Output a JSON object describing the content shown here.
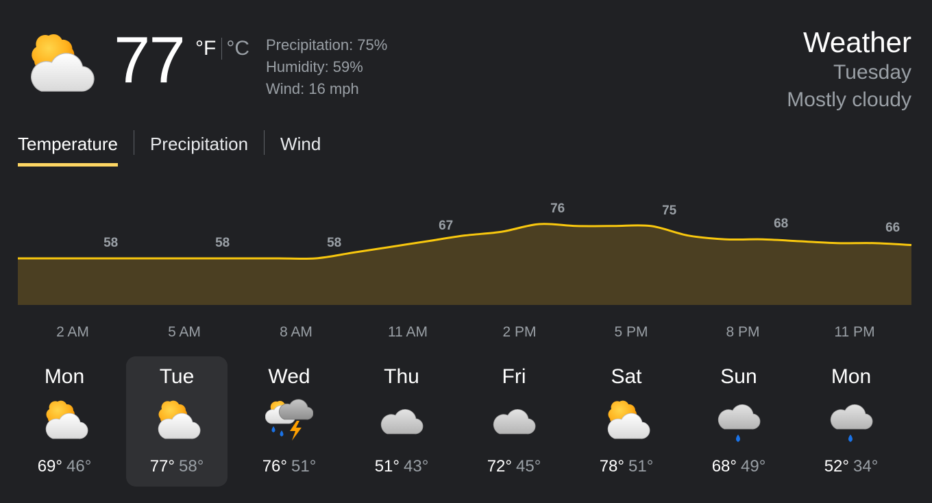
{
  "current": {
    "icon": "partly-cloudy-icon",
    "temperature": "77",
    "unit_f": "°F",
    "unit_c": "°C",
    "precipitation": "Precipitation: 75%",
    "humidity": "Humidity: 59%",
    "wind": "Wind: 16 mph"
  },
  "header": {
    "title": "Weather",
    "day": "Tuesday",
    "condition": "Mostly cloudy"
  },
  "tabs": [
    {
      "label": "Temperature",
      "active": true
    },
    {
      "label": "Precipitation",
      "active": false
    },
    {
      "label": "Wind",
      "active": false
    }
  ],
  "colors": {
    "background": "#202124",
    "accent": "#fdd663",
    "area_fill": "#4b3f22",
    "line": "#f9c80e",
    "selected_day": "#303134"
  },
  "chart_data": {
    "type": "area",
    "x": [
      "12 AM",
      "1 AM",
      "2 AM",
      "3 AM",
      "4 AM",
      "5 AM",
      "6 AM",
      "7 AM",
      "8 AM",
      "9 AM",
      "10 AM",
      "11 AM",
      "12 PM",
      "1 PM",
      "2 PM",
      "3 PM",
      "4 PM",
      "5 PM",
      "6 PM",
      "7 PM",
      "8 PM",
      "9 PM",
      "10 PM",
      "11 PM",
      "12 AM"
    ],
    "values": [
      58,
      58,
      58,
      58,
      58,
      58,
      58,
      58,
      58,
      61,
      64,
      67,
      70,
      72,
      76,
      75,
      75,
      75,
      70,
      68,
      68,
      67,
      66,
      66,
      65
    ],
    "labeled_points": [
      {
        "x": "2 AM",
        "value": "58"
      },
      {
        "x": "5 AM",
        "value": "58"
      },
      {
        "x": "8 AM",
        "value": "58"
      },
      {
        "x": "11 AM",
        "value": "67"
      },
      {
        "x": "2 PM",
        "value": "76"
      },
      {
        "x": "5 PM",
        "value": "75"
      },
      {
        "x": "8 PM",
        "value": "68"
      },
      {
        "x": "11 PM",
        "value": "66"
      }
    ],
    "tick_labels": [
      "2 AM",
      "5 AM",
      "8 AM",
      "11 AM",
      "2 PM",
      "5 PM",
      "8 PM",
      "11 PM"
    ],
    "ylim": [
      0,
      100
    ],
    "grid": false
  },
  "forecast": [
    {
      "day": "Mon",
      "icon": "partly-cloudy-icon",
      "high": "69°",
      "low": "46°",
      "selected": false
    },
    {
      "day": "Tue",
      "icon": "partly-cloudy-icon",
      "high": "77°",
      "low": "58°",
      "selected": true
    },
    {
      "day": "Wed",
      "icon": "thunderstorm-rain-icon",
      "high": "76°",
      "low": "51°",
      "selected": false
    },
    {
      "day": "Thu",
      "icon": "cloudy-icon",
      "high": "51°",
      "low": "43°",
      "selected": false
    },
    {
      "day": "Fri",
      "icon": "cloudy-icon",
      "high": "72°",
      "low": "45°",
      "selected": false
    },
    {
      "day": "Sat",
      "icon": "partly-cloudy-icon",
      "high": "78°",
      "low": "51°",
      "selected": false
    },
    {
      "day": "Sun",
      "icon": "rain-icon",
      "high": "68°",
      "low": "49°",
      "selected": false
    },
    {
      "day": "Mon",
      "icon": "rain-icon",
      "high": "52°",
      "low": "34°",
      "selected": false
    }
  ]
}
